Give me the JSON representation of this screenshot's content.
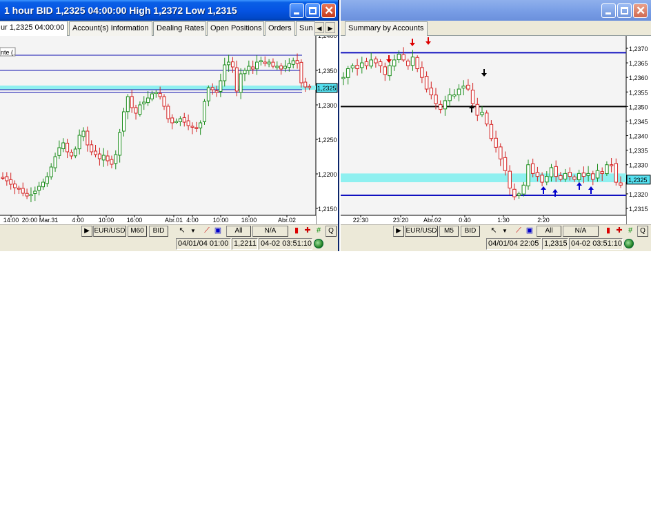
{
  "left_window": {
    "title": "1 hour BID 1,2325 04:00:00 High 1,2372 Low 1,2315",
    "tabs": [
      "ur 1,2325 04:00:00",
      "Account(s) Information",
      "Dealing Rates",
      "Open Positions",
      "Orders",
      "Sun"
    ],
    "legend_fragment": "nte (.",
    "price_labels": [
      "1,2350",
      "1,2300",
      "1,2250",
      "1,2200",
      "1,2150"
    ],
    "top_price_label": "1,2400",
    "current_price_label": "1,2325",
    "time_labels": [
      "14:00",
      "20:00 Mar.31",
      "4:00",
      "10:00",
      "16:00",
      "Abr.01",
      "4:00",
      "10:00",
      "16:00",
      "Abr.02"
    ],
    "toolbar": {
      "play": "▶",
      "symbol": "EUR/USD",
      "period": "M60",
      "side": "BID",
      "all": "All",
      "na": "N/A",
      "q": "Q"
    },
    "status": {
      "time_value": "04/01/04 01:00",
      "price": "1,2211",
      "clock": "04-02 03:51:10"
    }
  },
  "right_window": {
    "tabs": [
      "Summary by Accounts"
    ],
    "price_labels": [
      "1,2370",
      "1,2365",
      "1,2360",
      "1,2355",
      "1,2350",
      "1,2345",
      "1,2340",
      "1,2335",
      "1,2330",
      "1,2320",
      "1,2315"
    ],
    "current_price_label": "1,2325",
    "time_labels": [
      "22:30",
      "23:20",
      "Abr.02",
      "0:40",
      "1:30",
      "2:20"
    ],
    "toolbar": {
      "play": "▶",
      "symbol": "EUR/USD",
      "period": "M5",
      "side": "BID",
      "all": "All",
      "na": "N/A",
      "q": "Q"
    },
    "status": {
      "time_value": "04/01/04 22:05",
      "price": "1,2315",
      "clock": "04-02 03:51:10"
    }
  },
  "colors": {
    "bull": "#1a8c1a",
    "bear": "#d42020",
    "hline": "#1010b0",
    "cyan_zone": "#8ff0f0",
    "price_tag": "#55e0f0",
    "chart_bg": "#f4f4f4"
  }
}
